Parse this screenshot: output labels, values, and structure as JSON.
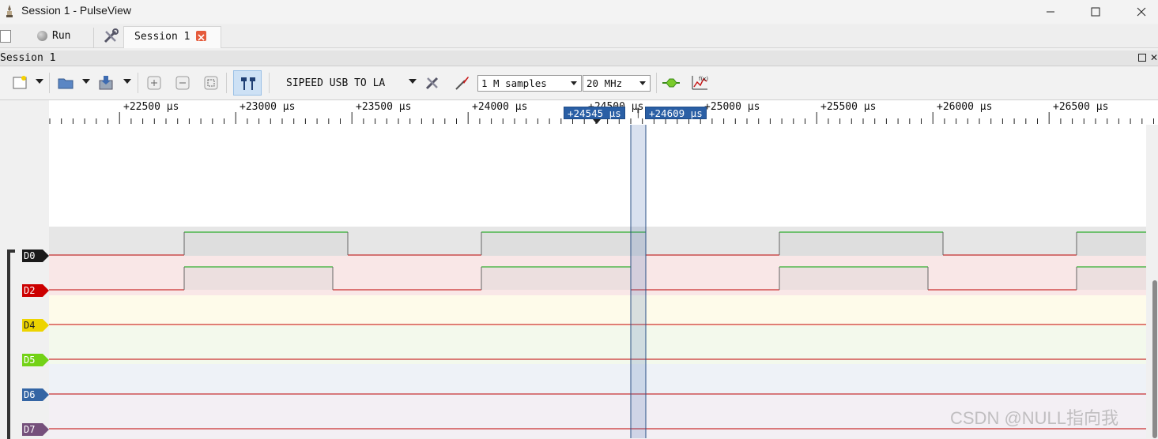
{
  "window": {
    "title": "Session 1 - PulseView",
    "minimize_icon": "minimize-icon",
    "maximize_icon": "maximize-icon",
    "close_icon": "close-icon"
  },
  "tabs": {
    "run_label": "Run",
    "session_tab_label": "Session 1"
  },
  "dock": {
    "title": "Session 1"
  },
  "toolbar": {
    "device": "SIPEED USB TO LA",
    "samples": "1 M samples",
    "rate": "20 MHz"
  },
  "ruler": {
    "unit": "μs",
    "ticks": [
      "+22500",
      "+23000",
      "+23500",
      "+24000",
      "+24500",
      "+25000",
      "+25500",
      "+26000",
      "+26500"
    ],
    "cursor_a": "+24545 μs",
    "cursor_b": "+24609 μs"
  },
  "channels": [
    {
      "name": "D0",
      "color": "#1a1a1a"
    },
    {
      "name": "D2",
      "color": "#cc0000"
    },
    {
      "name": "D4",
      "color": "#edd400"
    },
    {
      "name": "D5",
      "color": "#73d216"
    },
    {
      "name": "D6",
      "color": "#3465a4"
    },
    {
      "name": "D7",
      "color": "#75507b"
    }
  ],
  "watermark": "CSDN @NULL指向我"
}
